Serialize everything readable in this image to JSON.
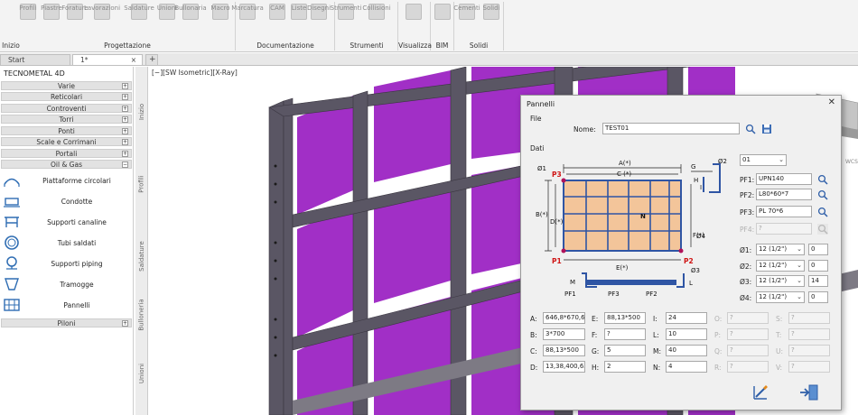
{
  "ribbon": {
    "buttons": [
      "Profili",
      "Piastre",
      "Forature",
      "Lavorazioni",
      "Saldature",
      "Unioni",
      "Bullonaria",
      "Macro",
      "Marcatura",
      "CAM",
      "Liste",
      "Disegni",
      "Strumenti",
      "Collisioni",
      "Cementi",
      "Solidi"
    ],
    "groups": [
      "Inizio",
      "Progettazione",
      "Documentazione",
      "Strumenti",
      "Visualizza",
      "BIM",
      "Solidi"
    ]
  },
  "tabs": [
    "Start",
    "1*"
  ],
  "sidebar": {
    "title": "TECNOMETAL 4D",
    "categories_top": [
      "Varie",
      "Reticolari",
      "Controventi",
      "Torri",
      "Ponti",
      "Scale e Corrimani",
      "Portali",
      "Oil & Gas"
    ],
    "items": [
      "Piattaforme circolari",
      "Condotte",
      "Supporti canaline",
      "Tubi saldati",
      "Supporti piping",
      "Tramogge",
      "Pannelli"
    ],
    "category_bottom": "Piloni"
  },
  "vtabs": [
    "Inizio",
    "Profili",
    "Saldature",
    "Bulloneria",
    "Unioni"
  ],
  "viewport": {
    "title": "[−][SW Isometric][X-Ray]",
    "corner_label": "WCS"
  },
  "dialog": {
    "title": "Pannelli",
    "file_group": "File",
    "name_label": "Nome:",
    "name_value": "TEST01",
    "dati_group": "Dati",
    "diagram": {
      "A": "A(*)",
      "C": "C (*)",
      "B": "B(*)",
      "D": "D(*)",
      "E": "E(*)",
      "F": "F(*)",
      "G": "G",
      "H": "H",
      "I": "I",
      "L": "L",
      "M": "M",
      "N": "N",
      "O1": "Ø1",
      "O2": "Ø2",
      "O3": "Ø3",
      "O4": "Ø4",
      "P1": "P1",
      "P2": "P2",
      "P3": "P3",
      "PF1": "PF1",
      "PF2": "PF2",
      "PF3": "PF3"
    },
    "preset": "01",
    "pf": [
      {
        "label": "PF1:",
        "value": "UPN140"
      },
      {
        "label": "PF2:",
        "value": "L80*60*7"
      },
      {
        "label": "PF3:",
        "value": "PL 70*6"
      },
      {
        "label": "PF4:",
        "value": "?"
      }
    ],
    "holes": [
      {
        "label": "Ø1:",
        "size": "12 (1/2\")",
        "value": "0"
      },
      {
        "label": "Ø2:",
        "size": "12 (1/2\")",
        "value": "0"
      },
      {
        "label": "Ø3:",
        "size": "12 (1/2\")",
        "value": "14"
      },
      {
        "label": "Ø4:",
        "size": "12 (1/2\")",
        "value": "0"
      }
    ],
    "params": [
      [
        {
          "label": "A:",
          "value": "646,8*670,655"
        },
        {
          "label": "E:",
          "value": "88,13*500"
        },
        {
          "label": "I:",
          "value": "24"
        },
        {
          "label": "O:",
          "value": "?"
        },
        {
          "label": "S:",
          "value": "?"
        }
      ],
      [
        {
          "label": "B:",
          "value": "3*700"
        },
        {
          "label": "F:",
          "value": "?"
        },
        {
          "label": "L:",
          "value": "10"
        },
        {
          "label": "P:",
          "value": "?"
        },
        {
          "label": "T:",
          "value": "?"
        }
      ],
      [
        {
          "label": "C:",
          "value": "88,13*500"
        },
        {
          "label": "G:",
          "value": "5"
        },
        {
          "label": "M:",
          "value": "40"
        },
        {
          "label": "Q:",
          "value": "?"
        },
        {
          "label": "U:",
          "value": "?"
        }
      ],
      [
        {
          "label": "D:",
          "value": "13,38,400,63,5"
        },
        {
          "label": "H:",
          "value": "2"
        },
        {
          "label": "N:",
          "value": "4"
        },
        {
          "label": "R:",
          "value": "?"
        },
        {
          "label": "V:",
          "value": "?"
        }
      ]
    ]
  },
  "colors": {
    "panel": "#a12fc6",
    "steel": "#5a5664",
    "highlight": "#cf1414",
    "fill": "#f3c59a"
  }
}
